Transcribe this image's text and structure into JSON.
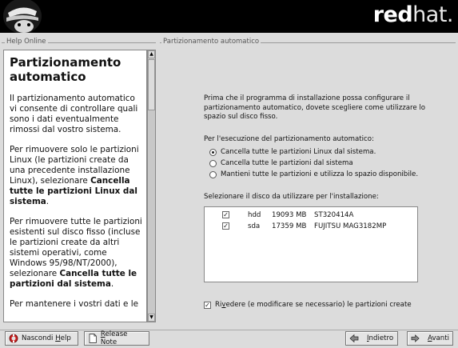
{
  "banner": {
    "brand_bold": "red",
    "brand_thin": "hat."
  },
  "help": {
    "frame_label": "Help Online",
    "title": "Partizionamento automatico",
    "paragraphs": [
      "Il partizionamento automatico vi consente di controllare quali sono i dati eventualmente rimossi dal vostro sistema.",
      "Per mantenere i vostri dati e le"
    ],
    "p2_prefix": "Per rimuovere solo le partizioni Linux (le partizioni create da una precedente installazione Linux), selezionare ",
    "p2_bold": "Cancella tutte le partizioni Linux dal sistema",
    "p2_suffix": ".",
    "p3_prefix": "Per rimuovere tutte le partizioni esistenti sul disco fisso (incluse le partizioni create da altri sistemi operativi, come Windows 95/98/NT/2000), selezionare ",
    "p3_bold": "Cancella tutte le partizioni dal sistema",
    "p3_suffix": "."
  },
  "main": {
    "frame_label": "Partizionamento automatico",
    "intro": "Prima che il programma di installazione possa configurare il partizionamento automatico, dovete scegliere come utilizzare lo spazio sul disco fisso.",
    "options_label": "Per l'esecuzione del partizionamento automatico:",
    "options": [
      {
        "label": "Cancella tutte le partizioni Linux dal sistema.",
        "selected": true
      },
      {
        "label": "Cancella tutte le partizioni dal sistema",
        "selected": false
      },
      {
        "label": "Mantieni tutte le partizioni e utilizza lo spazio disponibile.",
        "selected": false
      }
    ],
    "disk_label": "Selezionare il disco da utilizzare per l'installazione:",
    "disks": [
      {
        "checked": true,
        "device": "hdd",
        "size": "19093 MB",
        "model": "ST320414A"
      },
      {
        "checked": true,
        "device": "sda",
        "size": "17359 MB",
        "model": "FUJITSU MAG3182MP"
      }
    ],
    "review_prefix": "Ri",
    "review_accel": "v",
    "review_suffix": "edere (e modificare se necessario) le partizioni create",
    "review_checked": true
  },
  "buttons": {
    "hide_help_prefix": "Nascondi ",
    "hide_help_accel": "H",
    "hide_help_suffix": "elp",
    "release_accel": "R",
    "release_suffix": "elease Note",
    "back_accel": "I",
    "back_suffix": "ndietro",
    "next_accel": "A",
    "next_suffix": "vanti"
  }
}
